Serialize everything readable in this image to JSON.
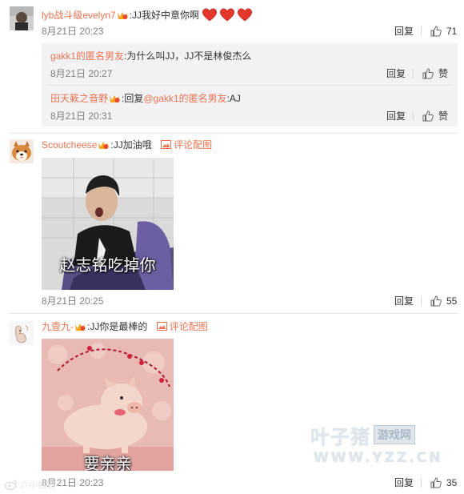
{
  "comments": [
    {
      "username": "lyb战斗级evelyn7",
      "text": ":JJ我好中意你啊",
      "time": "8月21日 20:23",
      "reply_label": "回复",
      "likes": "71",
      "replies": [
        {
          "username": "gakk1的匿名男友",
          "text": ":为什么叫JJ，JJ不是林俊杰么",
          "time": "8月21日 20:27",
          "reply_label": "回复",
          "like_label": "赞"
        },
        {
          "username": "田天簌之音野",
          "prefix": ":回复",
          "mention": "@gakk1的匿名男友",
          "text": ":AJ",
          "time": "8月21日 20:31",
          "reply_label": "回复",
          "like_label": "赞"
        }
      ]
    },
    {
      "username": "Scoutcheese",
      "text": ":JJ加油哦",
      "pic_label": "评论配图",
      "image_caption": "赵志铭吃掉你",
      "time": "8月21日 20:25",
      "reply_label": "回复",
      "likes": "55"
    },
    {
      "username": "九壹九-",
      "text": ":JJ你是最棒的",
      "pic_label": "评论配图",
      "image_caption": "要亲亲",
      "time": "8月21日 20:23",
      "reply_label": "回复",
      "likes": "35"
    }
  ],
  "watermark": {
    "brand": "叶子猪",
    "brand_sub": "游戏网",
    "url": "WWW.YZZ.CN",
    "weibo_mark": "六小猫猫"
  },
  "colors": {
    "link": "#eb7350",
    "text": "#333333",
    "muted": "#808080",
    "subbox": "#f2f2f5",
    "divider": "#e6e6e6"
  }
}
